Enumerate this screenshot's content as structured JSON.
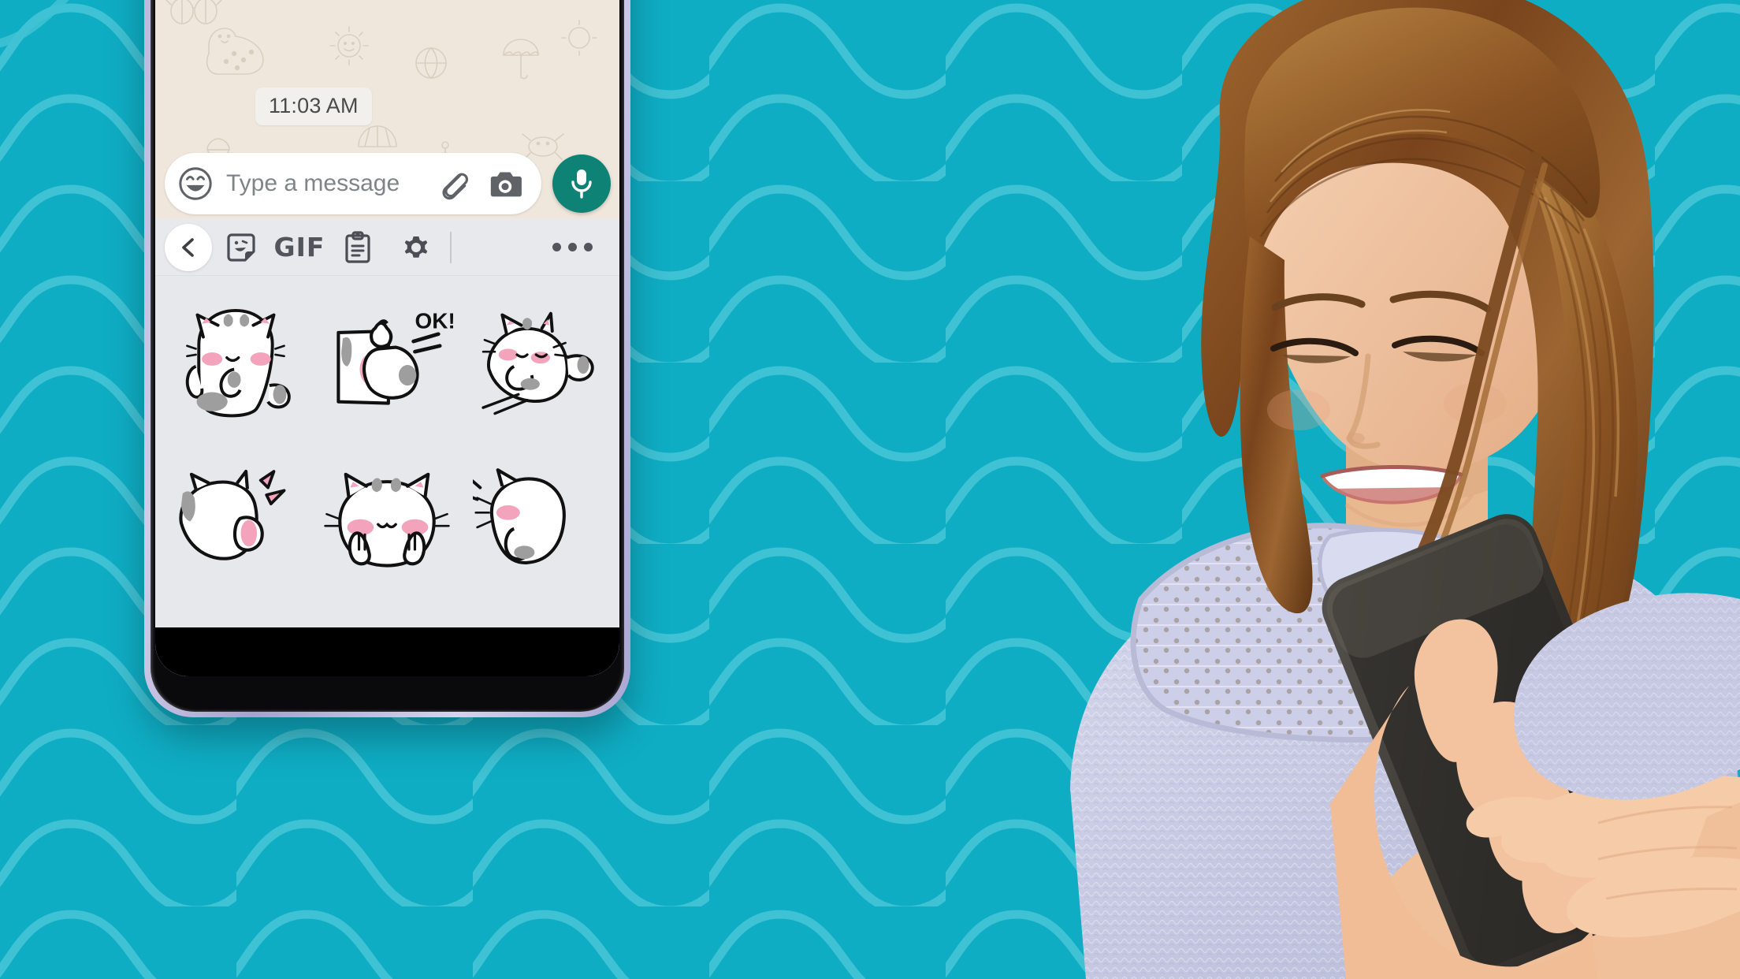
{
  "background": {
    "color": "#0FADC4",
    "wave_line_color": "#3FC2D4",
    "pattern": "wavy-lines"
  },
  "phone": {
    "frame_color": "#b9b4dd",
    "bezel_color": "#0a0a0c",
    "screen_background": "#EDEEF1"
  },
  "chat": {
    "wallpaper_color": "#EFE7DC",
    "doodle_theme": "beach-doodles",
    "timestamp": "11:03 AM",
    "sticker_emoji": "screaming-face-3d"
  },
  "input_bar": {
    "placeholder": "Type a message",
    "emoji_icon": "smiley-face-icon",
    "attach_icon": "paperclip-icon",
    "camera_icon": "camera-icon",
    "mic_icon": "microphone-icon",
    "mic_button_color": "#0e8274",
    "pill_color": "#ffffff"
  },
  "sticker_toolbar": {
    "background": "#E8E9EC",
    "items": [
      {
        "id": "back",
        "icon": "chevron-left-icon",
        "label": ""
      },
      {
        "id": "stickers",
        "icon": "sticker-face-icon",
        "label": ""
      },
      {
        "id": "gif",
        "icon": "gif-text-icon",
        "label": "GIF"
      },
      {
        "id": "clipboard",
        "icon": "clipboard-icon",
        "label": ""
      },
      {
        "id": "settings",
        "icon": "gear-icon",
        "label": ""
      },
      {
        "id": "more",
        "icon": "more-horizontal-icon",
        "label": ""
      }
    ]
  },
  "sticker_grid": {
    "background": "#E6E8EB",
    "columns": 3,
    "rows": 2,
    "stickers": [
      {
        "id": "cat-sitting",
        "name": "white-cat-sitting-sticker",
        "caption": ""
      },
      {
        "id": "cat-ok",
        "name": "white-cat-ok-sticker",
        "caption": "OK!"
      },
      {
        "id": "cat-lying",
        "name": "white-cat-lying-sticker",
        "caption": ""
      },
      {
        "id": "cat-back",
        "name": "white-cat-back-turned-sticker",
        "caption": ""
      },
      {
        "id": "cat-paws-up",
        "name": "white-cat-paws-up-sticker",
        "caption": ""
      },
      {
        "id": "cat-partial",
        "name": "white-cat-hidden-sticker",
        "caption": ""
      }
    ],
    "sticker_colors": {
      "body": "#ffffff",
      "outline": "#111111",
      "cheek": "#F4A3BC",
      "marking": "#9E9E9E"
    }
  },
  "photo": {
    "subject": "woman-using-smartphone",
    "hair_color": "#8B5A2B",
    "sweater_color": "#C9CBE4",
    "phone_color": "#3A3733",
    "skin_color": "#F3C6A5"
  }
}
